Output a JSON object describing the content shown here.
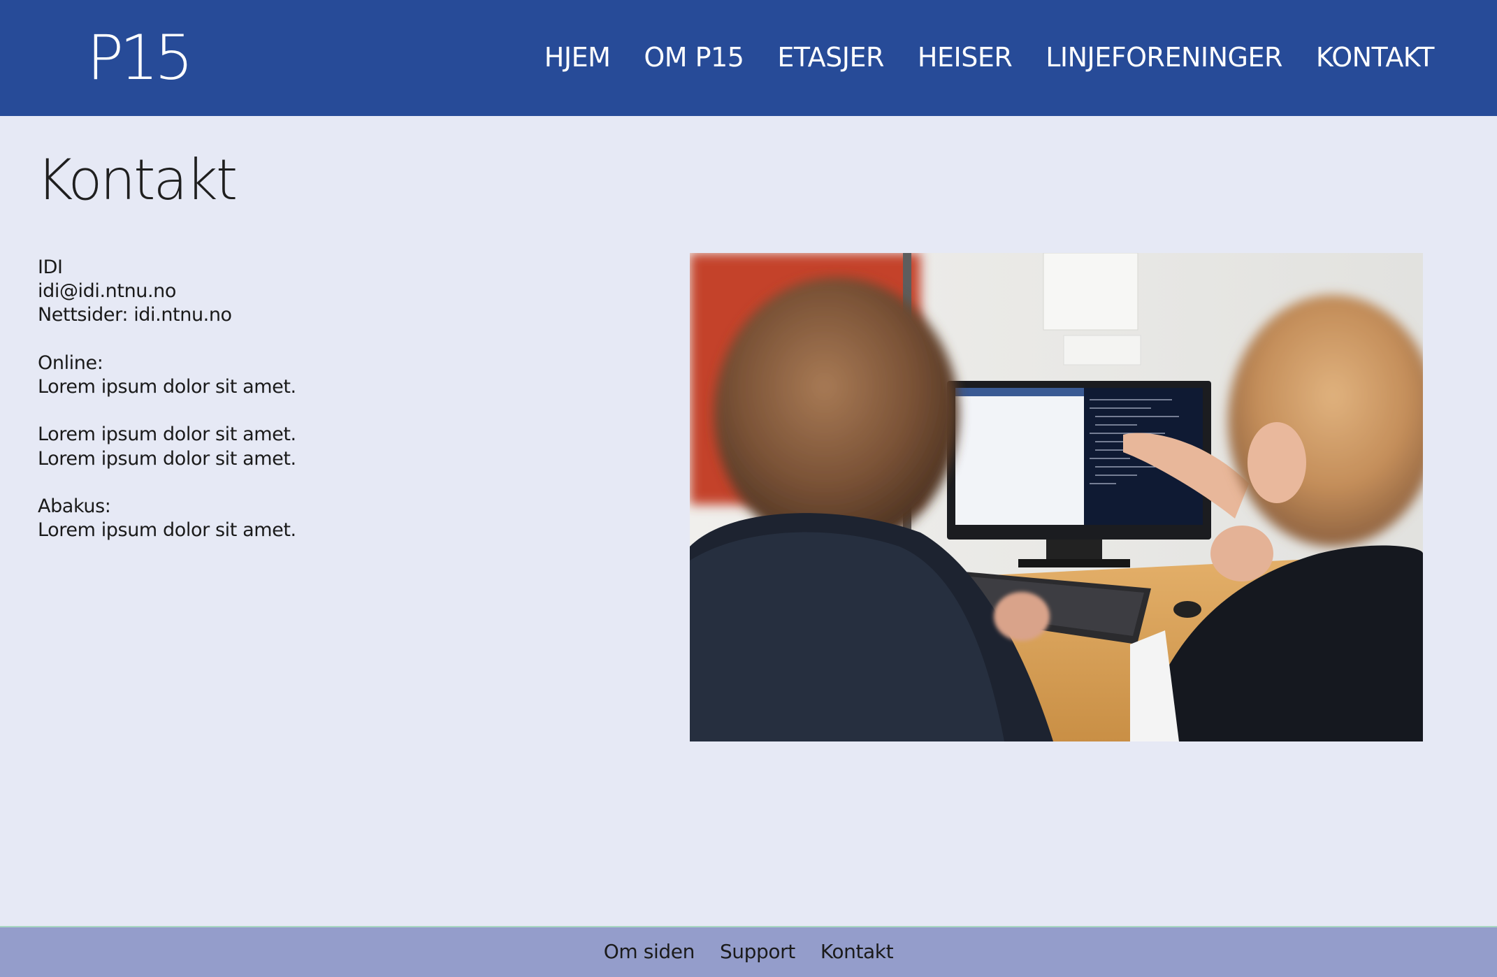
{
  "header": {
    "logo_text": "P15",
    "background_color": "#274b98",
    "nav": [
      {
        "label": "HJEM"
      },
      {
        "label": "OM P15"
      },
      {
        "label": "ETASJER"
      },
      {
        "label": "HEISER"
      },
      {
        "label": "LINJEFORENINGER"
      },
      {
        "label": "KONTAKT"
      }
    ]
  },
  "main": {
    "title": "Kontakt",
    "background_color": "#e6e9f5",
    "contact_lines": [
      "IDI",
      "idi@idi.ntnu.no",
      "Nettsider: idi.ntnu.no",
      "Online:",
      "Lorem ipsum dolor sit amet.",
      "Lorem ipsum dolor sit amet.",
      "Lorem ipsum dolor sit amet.",
      "Abakus:",
      "Lorem ipsum dolor sit amet."
    ],
    "photo_icon": "photo-two-people-at-computer"
  },
  "footer": {
    "background_color": "#949dcb",
    "links": [
      {
        "label": "Om siden"
      },
      {
        "label": "Support"
      },
      {
        "label": "Kontakt"
      }
    ]
  }
}
